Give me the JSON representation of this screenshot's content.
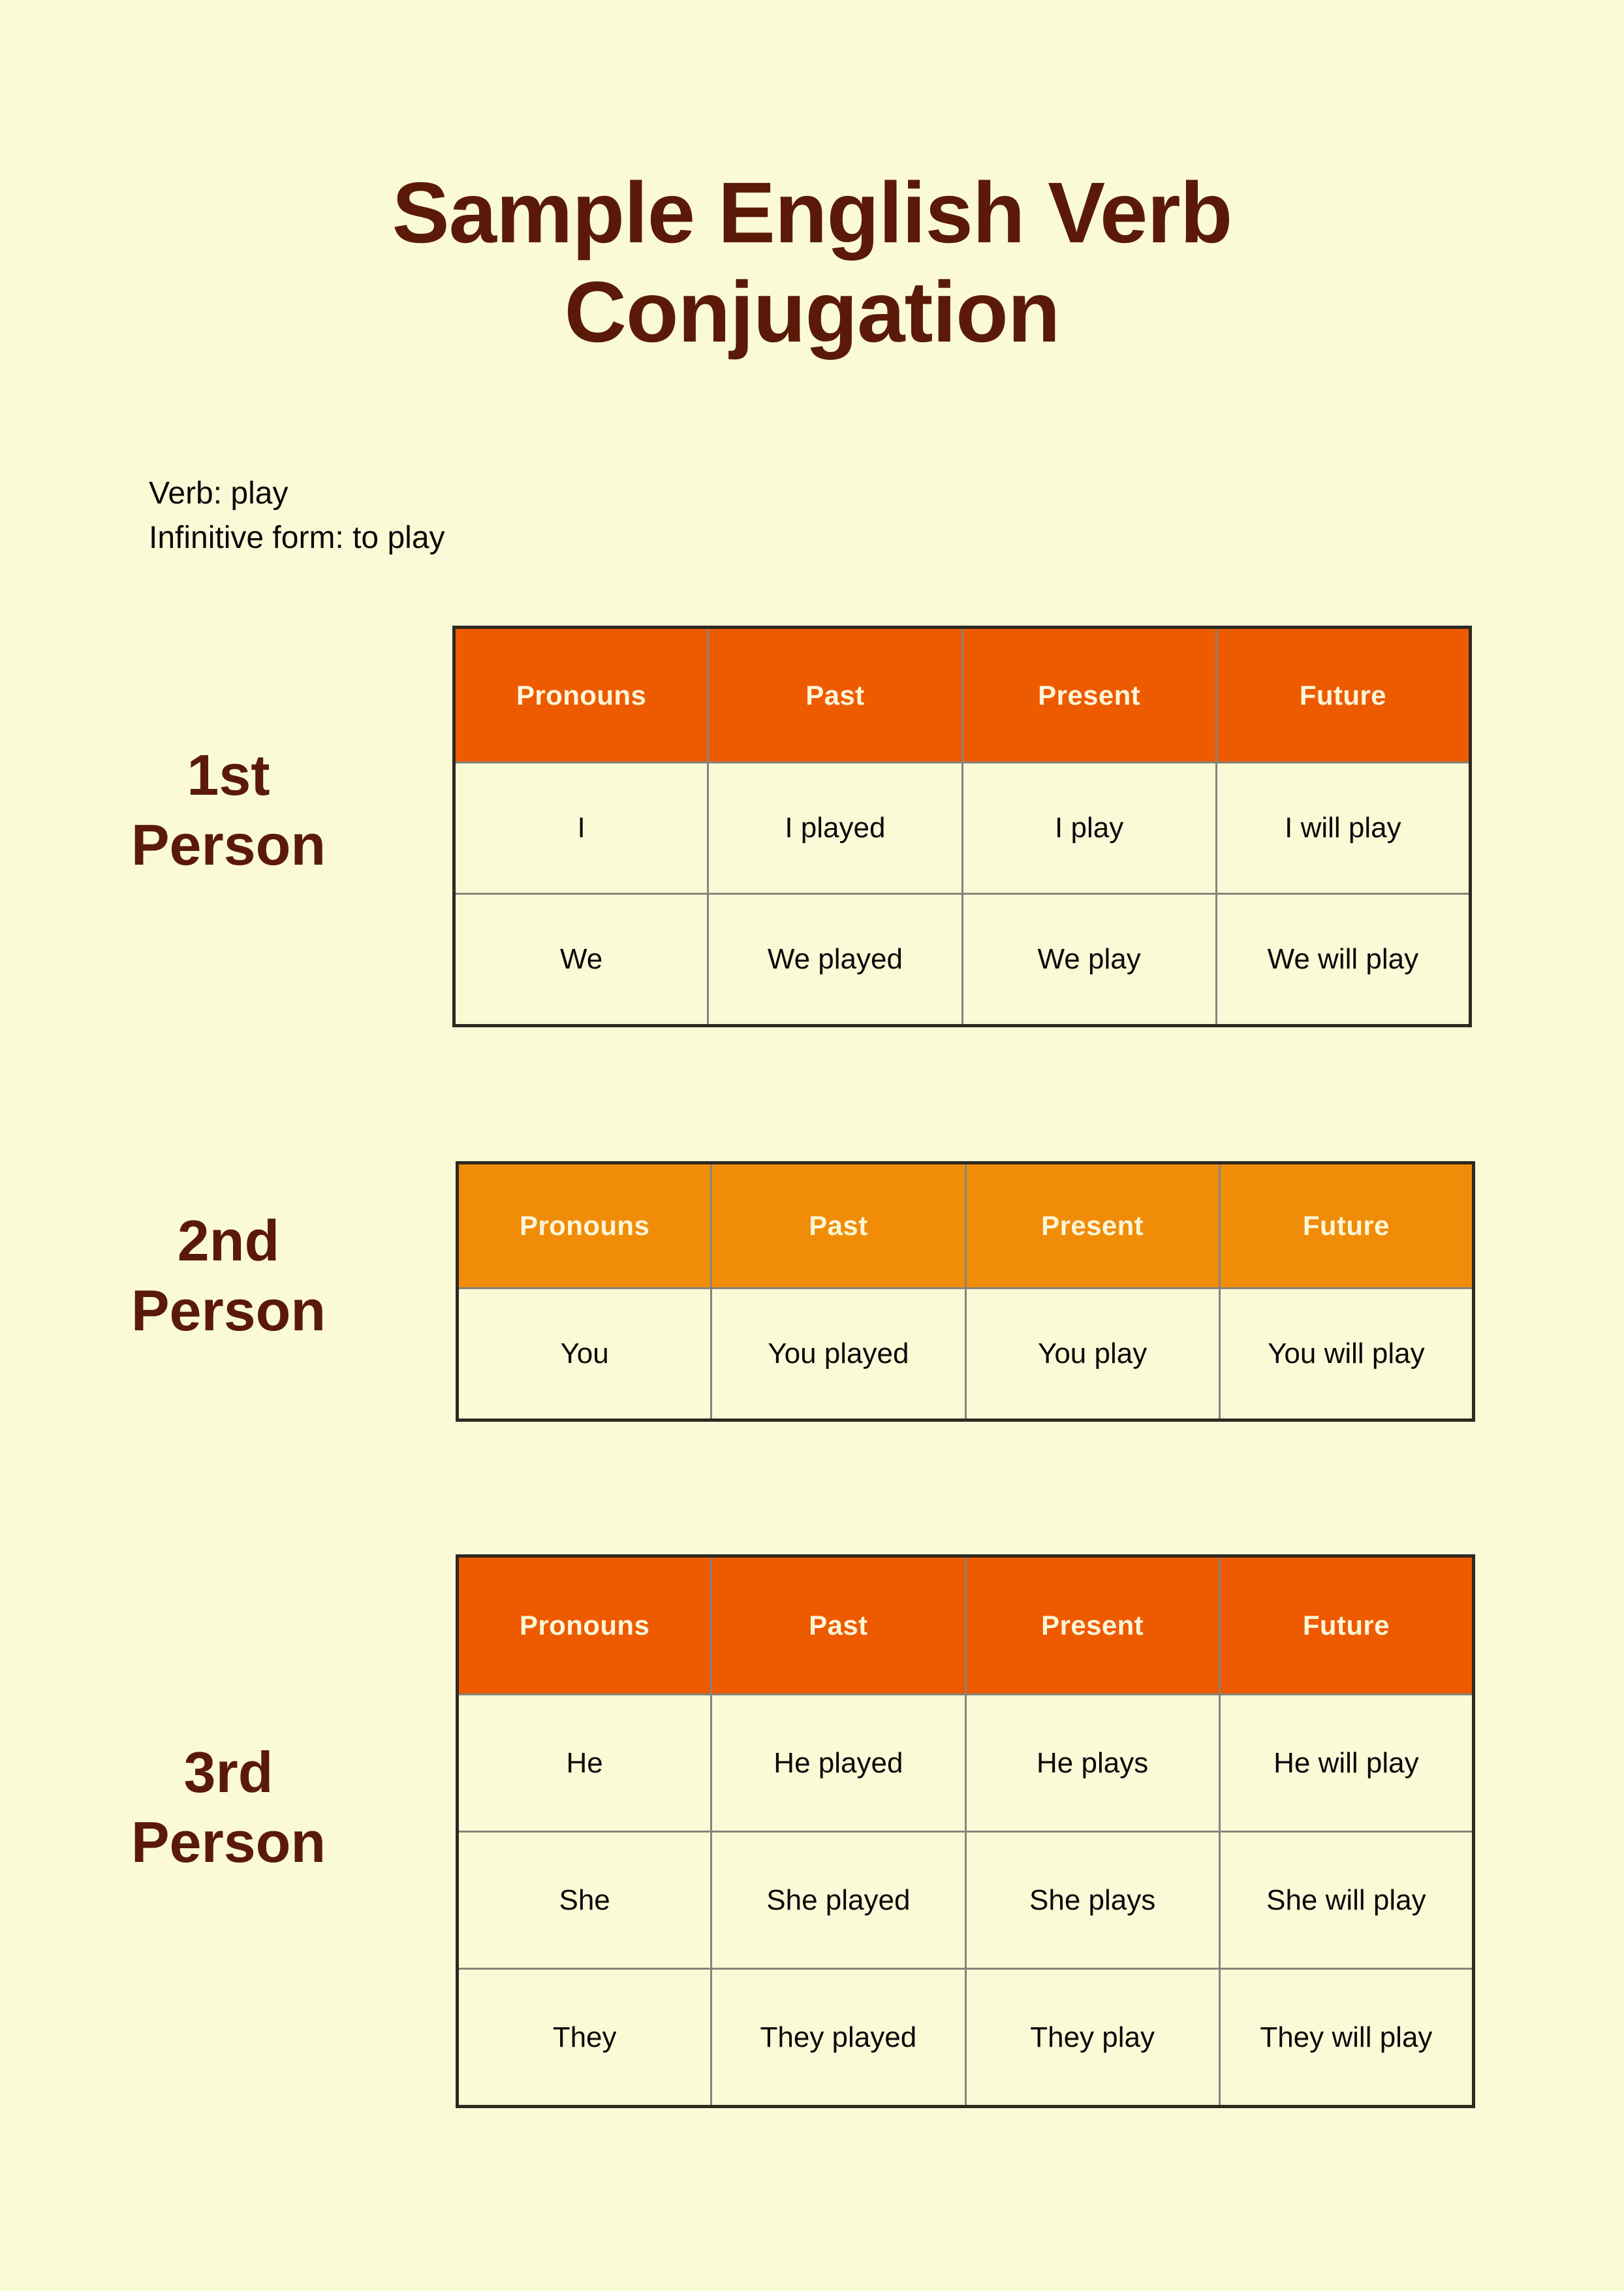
{
  "page": {
    "background_color": "#FAFAD7",
    "heading_color": "#5B1A08",
    "body_text_color": "#0A0A0A",
    "accent_deep_orange": "#EE5A00",
    "accent_amber_orange": "#F08C08",
    "header_text_color": "#FDF6D8",
    "cell_border_color": "#85857B",
    "table_outer_border_color": "#2E2A22"
  },
  "title": {
    "line1": "Sample English Verb",
    "line2": "Conjugation"
  },
  "meta": {
    "verb_line": "Verb: play",
    "infinitive_line": "Infinitive form: to play"
  },
  "columns": [
    "Pronouns",
    "Past",
    "Present",
    "Future"
  ],
  "sections": [
    {
      "id": "section-1",
      "label_line1": "1st",
      "label_line2": "Person",
      "header_style": "deep",
      "header_color": "#EE5A00",
      "columns": [
        "Pronouns",
        "Past",
        "Present",
        "Future"
      ],
      "rows": [
        [
          "I",
          "I played",
          "I play",
          "I will play"
        ],
        [
          "We",
          "We played",
          "We play",
          "We will play"
        ]
      ]
    },
    {
      "id": "section-2",
      "label_line1": "2nd",
      "label_line2": "Person",
      "header_style": "amber",
      "header_color": "#F08C08",
      "columns": [
        "Pronouns",
        "Past",
        "Present",
        "Future"
      ],
      "rows": [
        [
          "You",
          "You played",
          "You play",
          "You will play"
        ]
      ]
    },
    {
      "id": "section-3",
      "label_line1": "3rd",
      "label_line2": "Person",
      "header_style": "deep",
      "header_color": "#EE5A00",
      "columns": [
        "Pronouns",
        "Past",
        "Present",
        "Future"
      ],
      "rows": [
        [
          "He",
          "He played",
          "He plays",
          "He will play"
        ],
        [
          "She",
          "She played",
          "She plays",
          "She will play"
        ],
        [
          "They",
          "They played",
          "They play",
          "They will play"
        ]
      ]
    }
  ]
}
